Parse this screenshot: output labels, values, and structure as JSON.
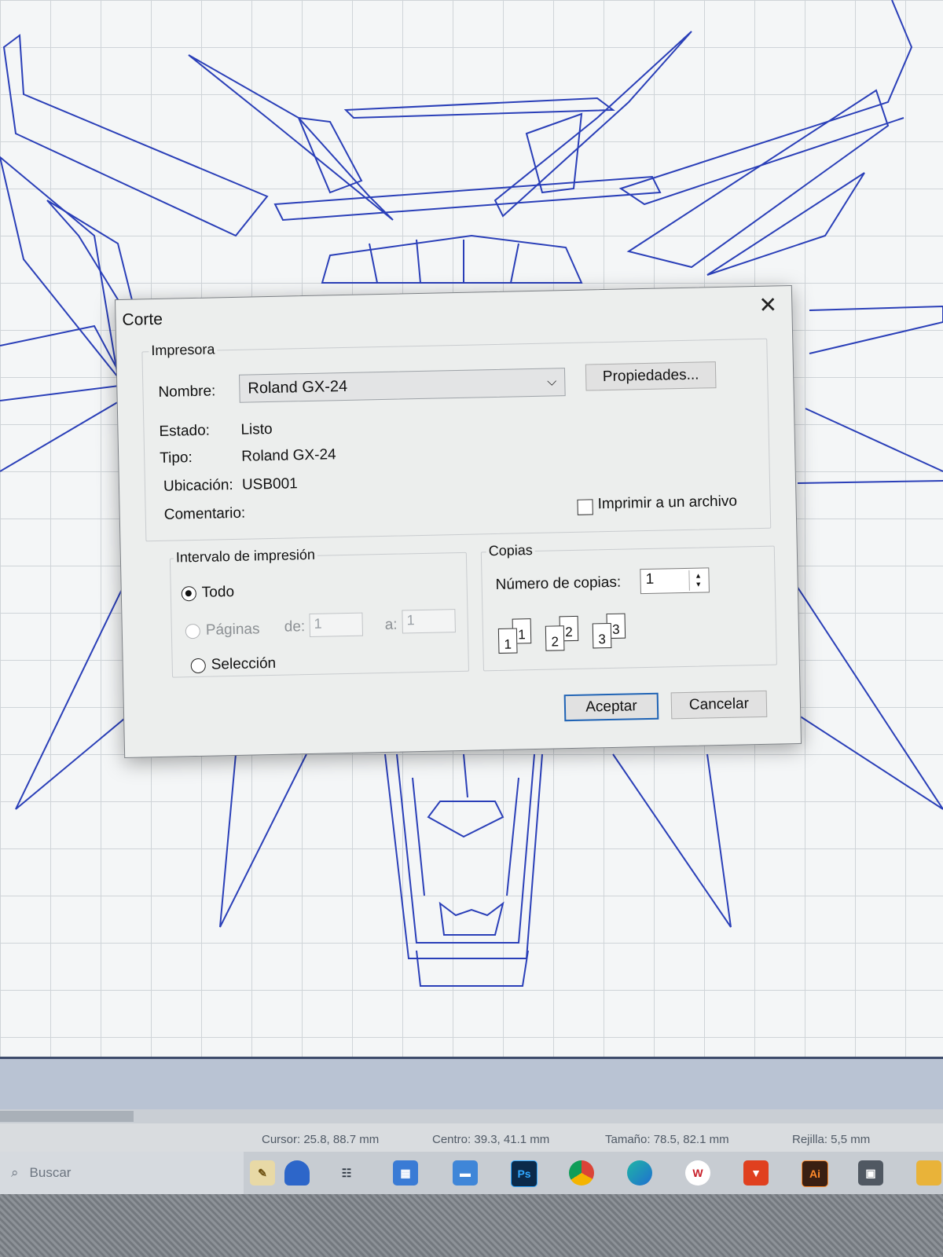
{
  "dialog": {
    "title": "Corte",
    "printer_group": {
      "label": "Impresora",
      "name_label": "Nombre:",
      "name_value": "Roland GX-24",
      "properties_button": "Propiedades...",
      "status_label": "Estado:",
      "status_value": "Listo",
      "type_label": "Tipo:",
      "type_value": "Roland GX-24",
      "location_label": "Ubicación:",
      "location_value": "USB001",
      "comment_label": "Comentario:",
      "comment_value": "",
      "print_to_file_label": "Imprimir a un archivo",
      "print_to_file_checked": false
    },
    "range_group": {
      "label": "Intervalo de impresión",
      "all_label": "Todo",
      "pages_label": "Páginas",
      "from_label": "de:",
      "from_value": "1",
      "to_label": "a:",
      "to_value": "1",
      "selection_label": "Selección",
      "selected": "all"
    },
    "copies_group": {
      "label": "Copias",
      "count_label": "Número de copias:",
      "count_value": "1",
      "collate_pages": [
        "1",
        "1",
        "2",
        "2",
        "3",
        "3"
      ]
    },
    "ok_button": "Aceptar",
    "cancel_button": "Cancelar"
  },
  "statusbar": {
    "cursor": "Cursor: 25.8, 88.7 mm",
    "center": "Centro: 39.3, 41.1 mm",
    "size": "Tamaño: 78.5, 82.1 mm",
    "grid": "Rejilla: 5,5 mm"
  },
  "taskbar": {
    "search_placeholder": "Buscar",
    "icons": [
      "notepad-icon",
      "app-icon",
      "task-view-icon",
      "store-icon",
      "explorer-icon",
      "photoshop-icon",
      "chrome-icon",
      "edge-icon",
      "office-icon",
      "brave-icon",
      "illustrator-icon",
      "media-icon",
      "folder-icon"
    ],
    "ps_label": "Ps",
    "ai_label": "Ai"
  },
  "colors": {
    "artwork_stroke": "#2a3fb8",
    "default_button_border": "#1f63b5",
    "photoshop": "#0b2a4a",
    "illustrator": "#3a1f12"
  }
}
